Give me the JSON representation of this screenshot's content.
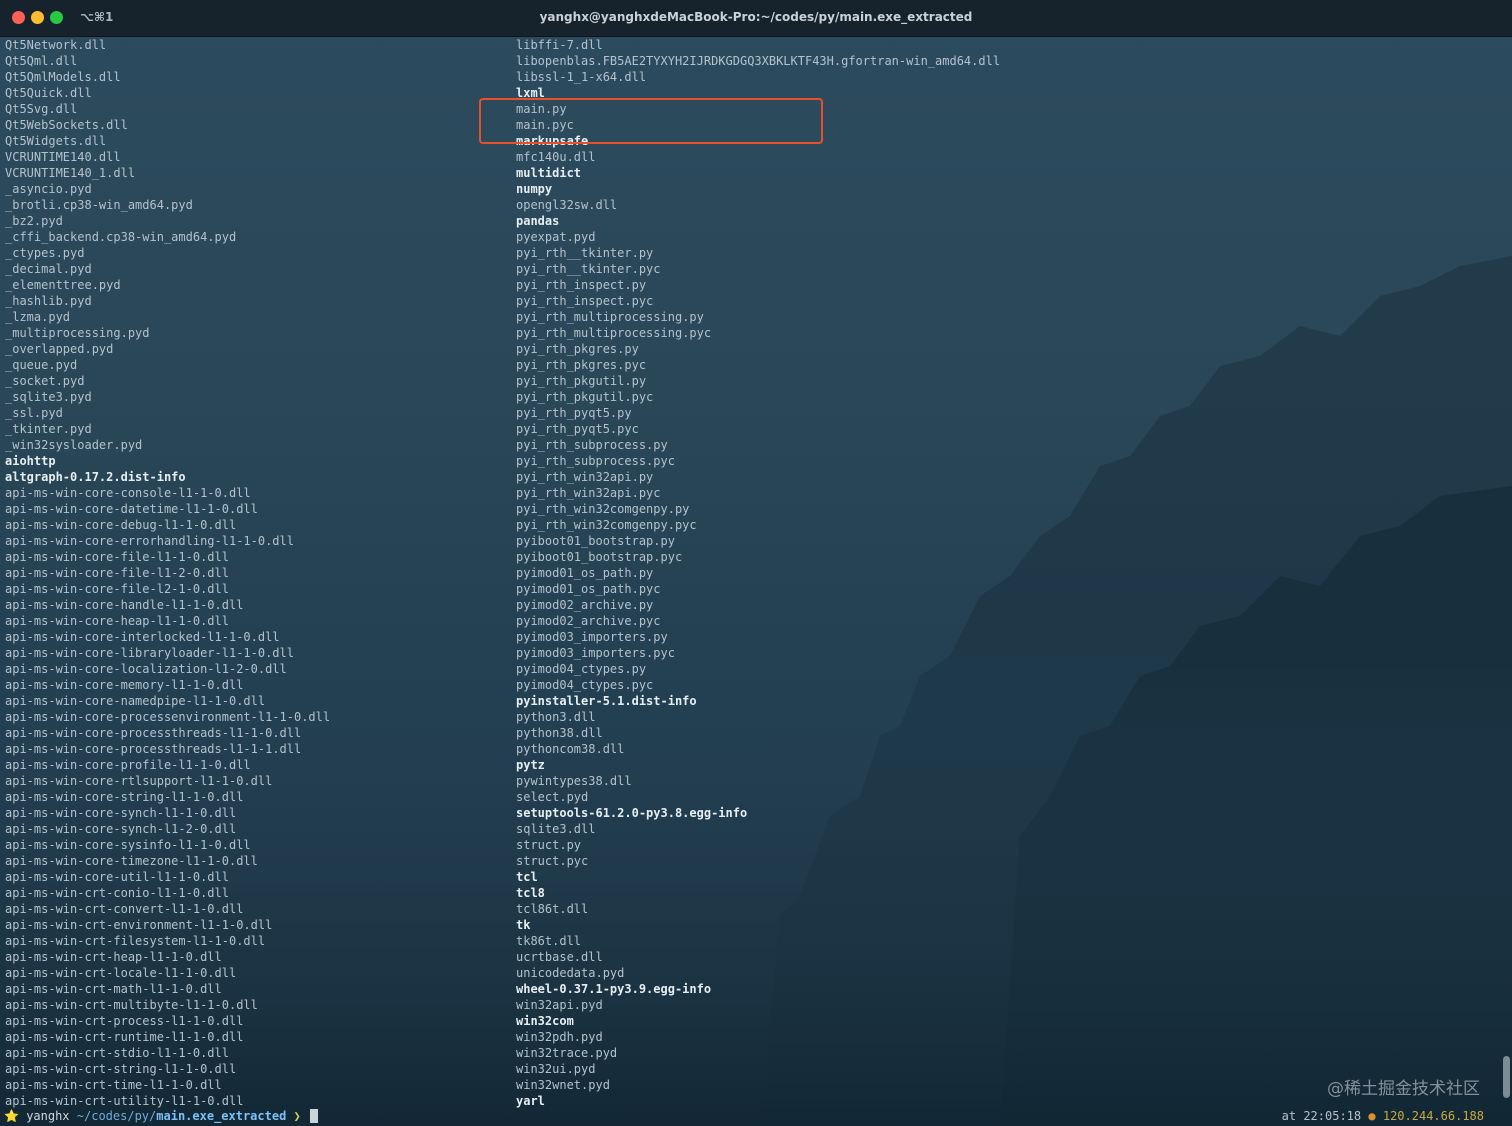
{
  "window": {
    "title": "yanghx@yanghxdeMacBook-Pro:~/codes/py/main.exe_extracted",
    "shortcut": "⌥⌘1"
  },
  "columns": [
    [
      {
        "name": "Qt5Network.dll",
        "dir": false
      },
      {
        "name": "Qt5Qml.dll",
        "dir": false
      },
      {
        "name": "Qt5QmlModels.dll",
        "dir": false
      },
      {
        "name": "Qt5Quick.dll",
        "dir": false
      },
      {
        "name": "Qt5Svg.dll",
        "dir": false
      },
      {
        "name": "Qt5WebSockets.dll",
        "dir": false
      },
      {
        "name": "Qt5Widgets.dll",
        "dir": false
      },
      {
        "name": "VCRUNTIME140.dll",
        "dir": false
      },
      {
        "name": "VCRUNTIME140_1.dll",
        "dir": false
      },
      {
        "name": "_asyncio.pyd",
        "dir": false
      },
      {
        "name": "_brotli.cp38-win_amd64.pyd",
        "dir": false
      },
      {
        "name": "_bz2.pyd",
        "dir": false
      },
      {
        "name": "_cffi_backend.cp38-win_amd64.pyd",
        "dir": false
      },
      {
        "name": "_ctypes.pyd",
        "dir": false
      },
      {
        "name": "_decimal.pyd",
        "dir": false
      },
      {
        "name": "_elementtree.pyd",
        "dir": false
      },
      {
        "name": "_hashlib.pyd",
        "dir": false
      },
      {
        "name": "_lzma.pyd",
        "dir": false
      },
      {
        "name": "_multiprocessing.pyd",
        "dir": false
      },
      {
        "name": "_overlapped.pyd",
        "dir": false
      },
      {
        "name": "_queue.pyd",
        "dir": false
      },
      {
        "name": "_socket.pyd",
        "dir": false
      },
      {
        "name": "_sqlite3.pyd",
        "dir": false
      },
      {
        "name": "_ssl.pyd",
        "dir": false
      },
      {
        "name": "_tkinter.pyd",
        "dir": false
      },
      {
        "name": "_win32sysloader.pyd",
        "dir": false
      },
      {
        "name": "aiohttp",
        "dir": true
      },
      {
        "name": "altgraph-0.17.2.dist-info",
        "dir": true
      },
      {
        "name": "api-ms-win-core-console-l1-1-0.dll",
        "dir": false
      },
      {
        "name": "api-ms-win-core-datetime-l1-1-0.dll",
        "dir": false
      },
      {
        "name": "api-ms-win-core-debug-l1-1-0.dll",
        "dir": false
      },
      {
        "name": "api-ms-win-core-errorhandling-l1-1-0.dll",
        "dir": false
      },
      {
        "name": "api-ms-win-core-file-l1-1-0.dll",
        "dir": false
      },
      {
        "name": "api-ms-win-core-file-l1-2-0.dll",
        "dir": false
      },
      {
        "name": "api-ms-win-core-file-l2-1-0.dll",
        "dir": false
      },
      {
        "name": "api-ms-win-core-handle-l1-1-0.dll",
        "dir": false
      },
      {
        "name": "api-ms-win-core-heap-l1-1-0.dll",
        "dir": false
      },
      {
        "name": "api-ms-win-core-interlocked-l1-1-0.dll",
        "dir": false
      },
      {
        "name": "api-ms-win-core-libraryloader-l1-1-0.dll",
        "dir": false
      },
      {
        "name": "api-ms-win-core-localization-l1-2-0.dll",
        "dir": false
      },
      {
        "name": "api-ms-win-core-memory-l1-1-0.dll",
        "dir": false
      },
      {
        "name": "api-ms-win-core-namedpipe-l1-1-0.dll",
        "dir": false
      },
      {
        "name": "api-ms-win-core-processenvironment-l1-1-0.dll",
        "dir": false
      },
      {
        "name": "api-ms-win-core-processthreads-l1-1-0.dll",
        "dir": false
      },
      {
        "name": "api-ms-win-core-processthreads-l1-1-1.dll",
        "dir": false
      },
      {
        "name": "api-ms-win-core-profile-l1-1-0.dll",
        "dir": false
      },
      {
        "name": "api-ms-win-core-rtlsupport-l1-1-0.dll",
        "dir": false
      },
      {
        "name": "api-ms-win-core-string-l1-1-0.dll",
        "dir": false
      },
      {
        "name": "api-ms-win-core-synch-l1-1-0.dll",
        "dir": false
      },
      {
        "name": "api-ms-win-core-synch-l1-2-0.dll",
        "dir": false
      },
      {
        "name": "api-ms-win-core-sysinfo-l1-1-0.dll",
        "dir": false
      },
      {
        "name": "api-ms-win-core-timezone-l1-1-0.dll",
        "dir": false
      },
      {
        "name": "api-ms-win-core-util-l1-1-0.dll",
        "dir": false
      },
      {
        "name": "api-ms-win-crt-conio-l1-1-0.dll",
        "dir": false
      },
      {
        "name": "api-ms-win-crt-convert-l1-1-0.dll",
        "dir": false
      },
      {
        "name": "api-ms-win-crt-environment-l1-1-0.dll",
        "dir": false
      },
      {
        "name": "api-ms-win-crt-filesystem-l1-1-0.dll",
        "dir": false
      },
      {
        "name": "api-ms-win-crt-heap-l1-1-0.dll",
        "dir": false
      },
      {
        "name": "api-ms-win-crt-locale-l1-1-0.dll",
        "dir": false
      },
      {
        "name": "api-ms-win-crt-math-l1-1-0.dll",
        "dir": false
      },
      {
        "name": "api-ms-win-crt-multibyte-l1-1-0.dll",
        "dir": false
      },
      {
        "name": "api-ms-win-crt-process-l1-1-0.dll",
        "dir": false
      },
      {
        "name": "api-ms-win-crt-runtime-l1-1-0.dll",
        "dir": false
      },
      {
        "name": "api-ms-win-crt-stdio-l1-1-0.dll",
        "dir": false
      },
      {
        "name": "api-ms-win-crt-string-l1-1-0.dll",
        "dir": false
      },
      {
        "name": "api-ms-win-crt-time-l1-1-0.dll",
        "dir": false
      },
      {
        "name": "api-ms-win-crt-utility-l1-1-0.dll",
        "dir": false
      }
    ],
    [
      {
        "name": "libffi-7.dll",
        "dir": false
      },
      {
        "name": "libopenblas.FB5AE2TYXYH2IJRDKGDGQ3XBKLKTF43H.gfortran-win_amd64.dll",
        "dir": false
      },
      {
        "name": "libssl-1_1-x64.dll",
        "dir": false
      },
      {
        "name": "lxml",
        "dir": true
      },
      {
        "name": "main.py",
        "dir": false
      },
      {
        "name": "main.pyc",
        "dir": false
      },
      {
        "name": "markupsafe",
        "dir": true
      },
      {
        "name": "mfc140u.dll",
        "dir": false
      },
      {
        "name": "multidict",
        "dir": true
      },
      {
        "name": "numpy",
        "dir": true
      },
      {
        "name": "opengl32sw.dll",
        "dir": false
      },
      {
        "name": "pandas",
        "dir": true
      },
      {
        "name": "pyexpat.pyd",
        "dir": false
      },
      {
        "name": "pyi_rth__tkinter.py",
        "dir": false
      },
      {
        "name": "pyi_rth__tkinter.pyc",
        "dir": false
      },
      {
        "name": "pyi_rth_inspect.py",
        "dir": false
      },
      {
        "name": "pyi_rth_inspect.pyc",
        "dir": false
      },
      {
        "name": "pyi_rth_multiprocessing.py",
        "dir": false
      },
      {
        "name": "pyi_rth_multiprocessing.pyc",
        "dir": false
      },
      {
        "name": "pyi_rth_pkgres.py",
        "dir": false
      },
      {
        "name": "pyi_rth_pkgres.pyc",
        "dir": false
      },
      {
        "name": "pyi_rth_pkgutil.py",
        "dir": false
      },
      {
        "name": "pyi_rth_pkgutil.pyc",
        "dir": false
      },
      {
        "name": "pyi_rth_pyqt5.py",
        "dir": false
      },
      {
        "name": "pyi_rth_pyqt5.pyc",
        "dir": false
      },
      {
        "name": "pyi_rth_subprocess.py",
        "dir": false
      },
      {
        "name": "pyi_rth_subprocess.pyc",
        "dir": false
      },
      {
        "name": "pyi_rth_win32api.py",
        "dir": false
      },
      {
        "name": "pyi_rth_win32api.pyc",
        "dir": false
      },
      {
        "name": "pyi_rth_win32comgenpy.py",
        "dir": false
      },
      {
        "name": "pyi_rth_win32comgenpy.pyc",
        "dir": false
      },
      {
        "name": "pyiboot01_bootstrap.py",
        "dir": false
      },
      {
        "name": "pyiboot01_bootstrap.pyc",
        "dir": false
      },
      {
        "name": "pyimod01_os_path.py",
        "dir": false
      },
      {
        "name": "pyimod01_os_path.pyc",
        "dir": false
      },
      {
        "name": "pyimod02_archive.py",
        "dir": false
      },
      {
        "name": "pyimod02_archive.pyc",
        "dir": false
      },
      {
        "name": "pyimod03_importers.py",
        "dir": false
      },
      {
        "name": "pyimod03_importers.pyc",
        "dir": false
      },
      {
        "name": "pyimod04_ctypes.py",
        "dir": false
      },
      {
        "name": "pyimod04_ctypes.pyc",
        "dir": false
      },
      {
        "name": "pyinstaller-5.1.dist-info",
        "dir": true
      },
      {
        "name": "python3.dll",
        "dir": false
      },
      {
        "name": "python38.dll",
        "dir": false
      },
      {
        "name": "pythoncom38.dll",
        "dir": false
      },
      {
        "name": "pytz",
        "dir": true
      },
      {
        "name": "pywintypes38.dll",
        "dir": false
      },
      {
        "name": "select.pyd",
        "dir": false
      },
      {
        "name": "setuptools-61.2.0-py3.8.egg-info",
        "dir": true
      },
      {
        "name": "sqlite3.dll",
        "dir": false
      },
      {
        "name": "struct.py",
        "dir": false
      },
      {
        "name": "struct.pyc",
        "dir": false
      },
      {
        "name": "tcl",
        "dir": true
      },
      {
        "name": "tcl8",
        "dir": true
      },
      {
        "name": "tcl86t.dll",
        "dir": false
      },
      {
        "name": "tk",
        "dir": true
      },
      {
        "name": "tk86t.dll",
        "dir": false
      },
      {
        "name": "ucrtbase.dll",
        "dir": false
      },
      {
        "name": "unicodedata.pyd",
        "dir": false
      },
      {
        "name": "wheel-0.37.1-py3.9.egg-info",
        "dir": true
      },
      {
        "name": "win32api.pyd",
        "dir": false
      },
      {
        "name": "win32com",
        "dir": true
      },
      {
        "name": "win32pdh.pyd",
        "dir": false
      },
      {
        "name": "win32trace.pyd",
        "dir": false
      },
      {
        "name": "win32ui.pyd",
        "dir": false
      },
      {
        "name": "win32wnet.pyd",
        "dir": false
      },
      {
        "name": "yarl",
        "dir": true
      }
    ]
  ],
  "prompt": {
    "star": "⭐",
    "user": "yanghx",
    "path_prefix": "~/codes/py/",
    "path_current": "main.exe_extracted",
    "arrow": "❯"
  },
  "right_prompt": {
    "time": "at 22:05:18",
    "dot": "●",
    "ip": "120.244.66.188"
  },
  "watermark": "@稀土掘金技术社区",
  "colors": {
    "highlight_box": "#e8502a",
    "directory_text": "#e7eef2",
    "file_text": "#b4c2cb",
    "path_highlight": "#7cc0f5"
  }
}
